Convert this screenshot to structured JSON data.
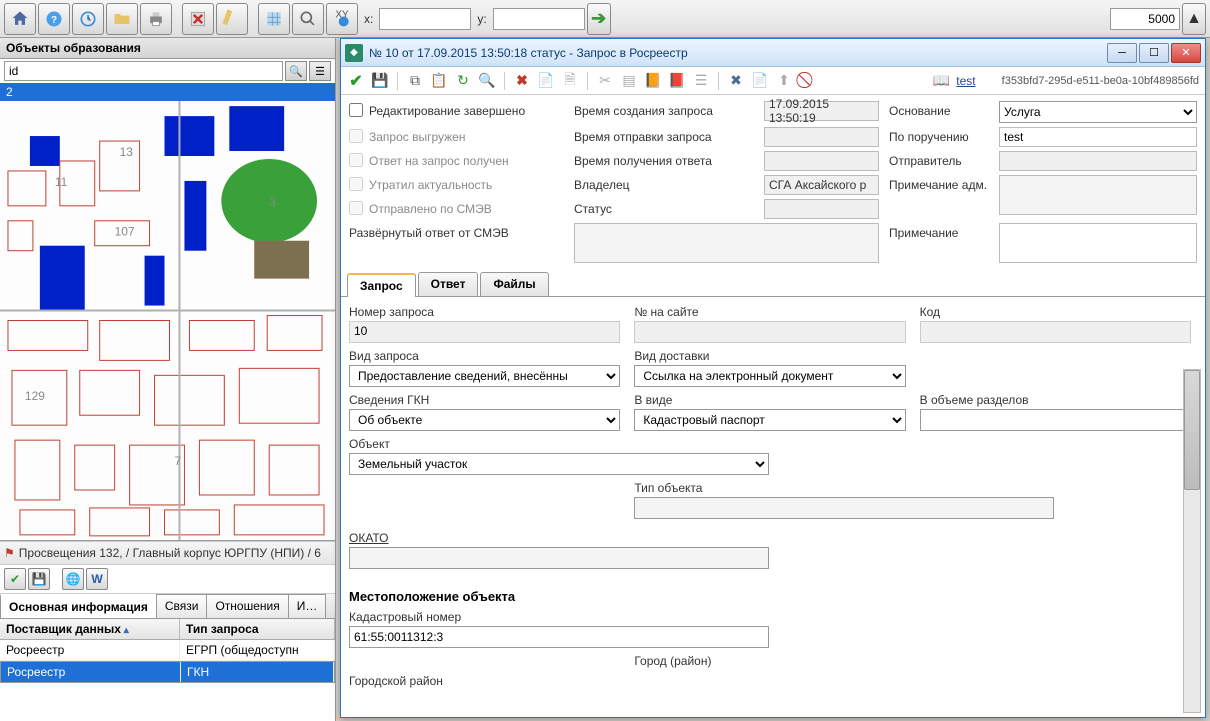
{
  "toolbar": {
    "x_label": "x:",
    "y_label": "y:",
    "x_value": "",
    "y_value": "",
    "scale_value": "5000"
  },
  "left": {
    "panel_title": "Объекты образования",
    "search_placeholder": "id",
    "result_first": "2",
    "breadcrumb": "Просвещения 132,  / Главный корпус ЮРГПУ (НПИ) / 6",
    "tabs": {
      "main": "Основная информация",
      "links": "Связи",
      "relations": "Отношения",
      "more": "И…"
    },
    "grid": {
      "col1": "Поставщик данных",
      "col2": "Тип запроса",
      "rows": [
        {
          "provider": "Росреестр",
          "type": "ЕГРП (общедоступн"
        },
        {
          "provider": "Росреестр",
          "type": "ГКН"
        }
      ]
    }
  },
  "modal": {
    "title": "№ 10 от 17.09.2015 13:50:18 статус - Запрос в Росреестр",
    "toolbar_link": "test",
    "guid": "f353bfd7-295d-e511-be0a-10bf489856fd",
    "form": {
      "edit_done": "Редактирование завершено",
      "uploaded": "Запрос выгружен",
      "response_rec": "Ответ на запрос получен",
      "lost": "Утратил актуальность",
      "smev_sent": "Отправлено по СМЭВ",
      "smev_full": "Развёрнутый ответ от СМЭВ",
      "time_create_l": "Время создания запроса",
      "time_create_v": "17.09.2015 13:50:19",
      "time_send_l": "Время отправки запроса",
      "time_recv_l": "Время получения ответа",
      "owner_l": "Владелец",
      "owner_v": "СГА Аксайского р",
      "status_l": "Статус",
      "basis_l": "Основание",
      "basis_v": "Услуга",
      "order_l": "По поручению",
      "order_v": "test",
      "sender_l": "Отправитель",
      "note_adm_l": "Примечание адм.",
      "note_l": "Примечание"
    },
    "tabs": {
      "req": "Запрос",
      "resp": "Ответ",
      "files": "Файлы"
    },
    "req": {
      "req_no_l": "Номер запроса",
      "req_no_v": "10",
      "site_no_l": "№ на сайте",
      "code_l": "Код",
      "req_type_l": "Вид запроса",
      "req_type_v": "Предоставление  сведений,  внесённы",
      "delivery_l": "Вид доставки",
      "delivery_v": "Ссылка на электронный документ",
      "gkn_l": "Сведения ГКН",
      "gkn_v": "Об объекте",
      "form_l": "В виде",
      "form_v": "Кадастровый паспорт",
      "vol_l": "В объеме разделов",
      "object_l": "Объект",
      "object_v": "Земельный участок",
      "obj_type_l": "Тип объекта",
      "okato_l": "ОКАТО",
      "location_title": "Местоположение объекта",
      "cad_no_l": "Кадастровый номер",
      "cad_no_v": "61:55:0011312:3",
      "city_l": "Город (район)",
      "city_area_l": "Городской район"
    }
  }
}
